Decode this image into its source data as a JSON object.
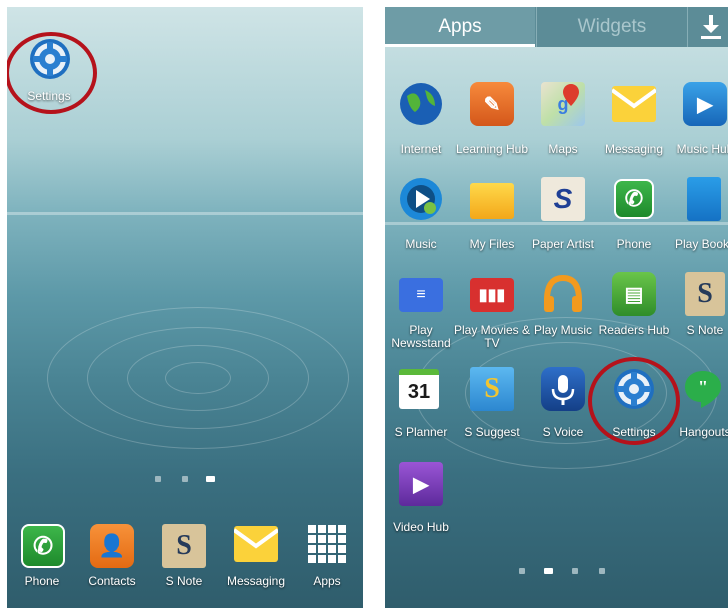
{
  "home": {
    "settings_label": "Settings",
    "dock": [
      {
        "label": "Phone",
        "icon": "phone-icon"
      },
      {
        "label": "Contacts",
        "icon": "contacts-icon"
      },
      {
        "label": "S Note",
        "icon": "s-note-icon"
      },
      {
        "label": "Messaging",
        "icon": "messaging-icon"
      },
      {
        "label": "Apps",
        "icon": "apps-grid-icon"
      }
    ],
    "page_count": 3,
    "active_page": 3
  },
  "drawer": {
    "tabs": {
      "apps": "Apps",
      "widgets": "Widgets"
    },
    "download_icon": "download-icon",
    "apps": [
      {
        "label": "Internet",
        "icon": "globe-icon"
      },
      {
        "label": "Learning Hub",
        "icon": "learning-hub-icon"
      },
      {
        "label": "Maps",
        "icon": "maps-icon"
      },
      {
        "label": "Messaging",
        "icon": "messaging-icon"
      },
      {
        "label": "Music Hub",
        "icon": "music-hub-icon"
      },
      {
        "label": "Music",
        "icon": "music-icon"
      },
      {
        "label": "My Files",
        "icon": "folder-icon"
      },
      {
        "label": "Paper Artist",
        "icon": "paper-artist-icon"
      },
      {
        "label": "Phone",
        "icon": "phone-icon"
      },
      {
        "label": "Play Books",
        "icon": "play-books-icon"
      },
      {
        "label": "Play Newsstand",
        "icon": "newsstand-icon"
      },
      {
        "label": "Play Movies & TV",
        "icon": "film-icon"
      },
      {
        "label": "Play Music",
        "icon": "headphones-icon"
      },
      {
        "label": "Readers Hub",
        "icon": "readers-hub-icon"
      },
      {
        "label": "S Note",
        "icon": "s-note-icon"
      },
      {
        "label": "S Planner",
        "icon": "calendar-icon"
      },
      {
        "label": "S Suggest",
        "icon": "s-suggest-icon"
      },
      {
        "label": "S Voice",
        "icon": "microphone-icon"
      },
      {
        "label": "Settings",
        "icon": "gear-icon"
      },
      {
        "label": "Hangouts",
        "icon": "hangouts-icon"
      },
      {
        "label": "Video Hub",
        "icon": "video-hub-icon"
      }
    ],
    "calendar_day": "31",
    "page_count": 4,
    "active_page": 2
  },
  "colors": {
    "highlight_ring": "#b5121b"
  }
}
